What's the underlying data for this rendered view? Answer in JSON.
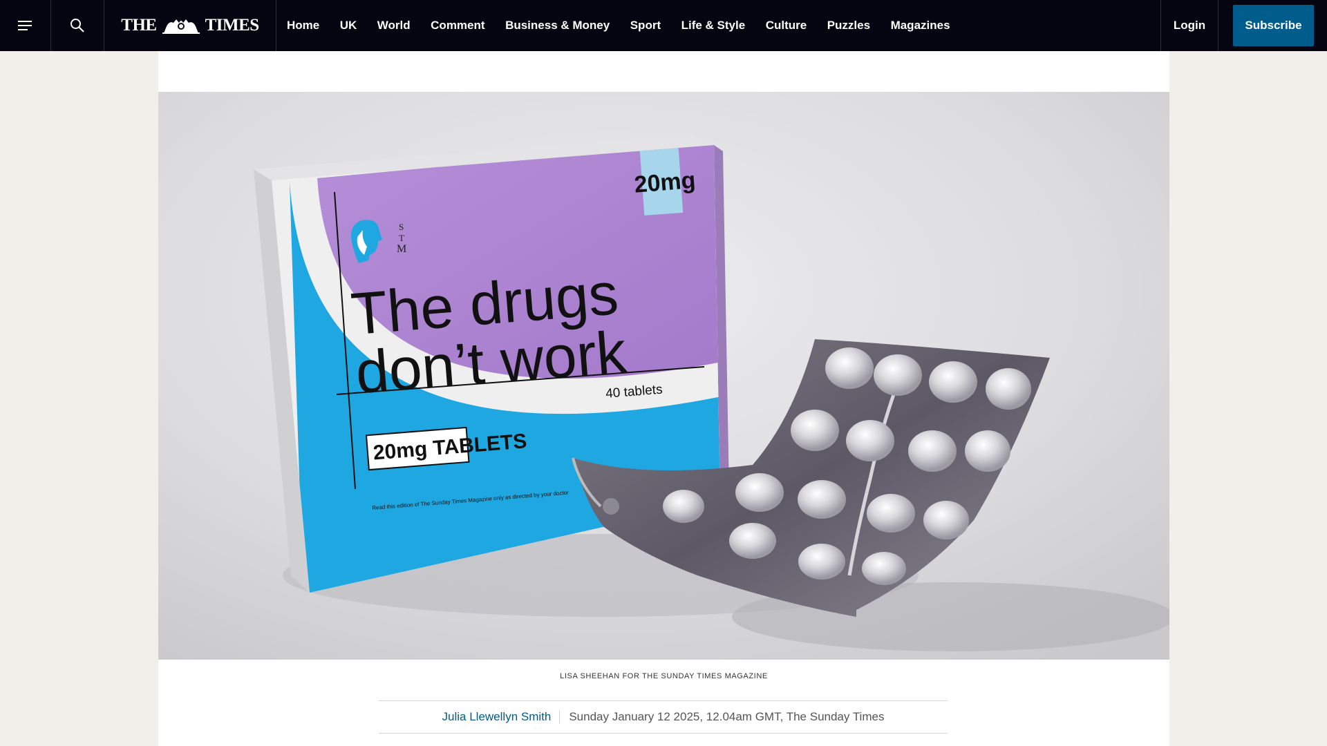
{
  "header": {
    "menu_icon": "menu-icon",
    "search_icon": "search-icon",
    "logo_text_left": "THE",
    "logo_text_right": "TIMES",
    "nav_items": [
      "Home",
      "UK",
      "World",
      "Comment",
      "Business & Money",
      "Sport",
      "Life & Style",
      "Culture",
      "Puzzles",
      "Magazines"
    ],
    "login_label": "Login",
    "subscribe_label": "Subscribe",
    "background": "#040510",
    "subscribe_color": "#005c8a"
  },
  "hero": {
    "box": {
      "strength": "20mg",
      "headline_line1": "The drugs",
      "headline_line2": "don’t work",
      "count": "40 tablets",
      "badge": "20mg TABLETS",
      "small_print": "Read this edition of The Sunday Times Magazine only as directed by your doctor",
      "logo_letters": [
        "S",
        "T",
        "M"
      ]
    },
    "caption": "LISA SHEEHAN FOR THE SUNDAY TIMES MAGAZINE"
  },
  "byline": {
    "author": "Julia Llewellyn Smith",
    "dateline": "Sunday January 12 2025, 12.04am GMT, The Sunday Times"
  }
}
